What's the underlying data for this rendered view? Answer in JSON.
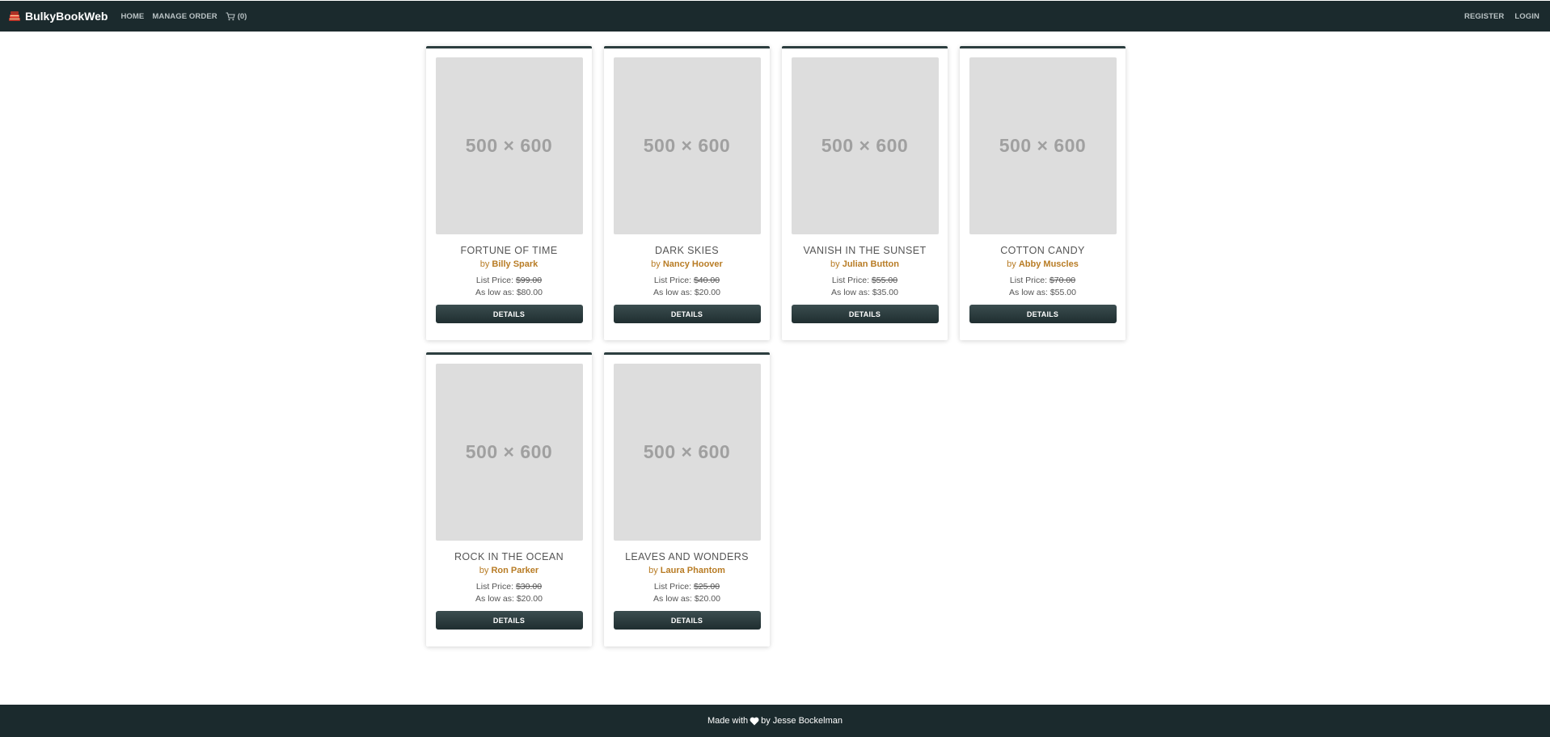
{
  "navbar": {
    "brand": "BulkyBookWeb",
    "brand_icon": "book-stack-icon",
    "links": {
      "home": "HOME",
      "manage_order": "MANAGE ORDER"
    },
    "cart": {
      "icon": "cart-icon",
      "count_label": "(0)"
    },
    "right": {
      "register": "REGISTER",
      "login": "LOGIN"
    }
  },
  "products": [
    {
      "image_label": "500 × 600",
      "title": "FORTUNE OF TIME",
      "by": "by",
      "author": "Billy Spark",
      "list_label": "List Price:",
      "list_price": "$99.00",
      "low_label": "As low as:",
      "low_price": "$80.00",
      "button": "DETAILS"
    },
    {
      "image_label": "500 × 600",
      "title": "DARK SKIES",
      "by": "by",
      "author": "Nancy Hoover",
      "list_label": "List Price:",
      "list_price": "$40.00",
      "low_label": "As low as:",
      "low_price": "$20.00",
      "button": "DETAILS"
    },
    {
      "image_label": "500 × 600",
      "title": "VANISH IN THE SUNSET",
      "by": "by",
      "author": "Julian Button",
      "list_label": "List Price:",
      "list_price": "$55.00",
      "low_label": "As low as:",
      "low_price": "$35.00",
      "button": "DETAILS"
    },
    {
      "image_label": "500 × 600",
      "title": "COTTON CANDY",
      "by": "by",
      "author": "Abby Muscles",
      "list_label": "List Price:",
      "list_price": "$70.00",
      "low_label": "As low as:",
      "low_price": "$55.00",
      "button": "DETAILS"
    },
    {
      "image_label": "500 × 600",
      "title": "ROCK IN THE OCEAN",
      "by": "by",
      "author": "Ron Parker",
      "list_label": "List Price:",
      "list_price": "$30.00",
      "low_label": "As low as:",
      "low_price": "$20.00",
      "button": "DETAILS"
    },
    {
      "image_label": "500 × 600",
      "title": "LEAVES AND WONDERS",
      "by": "by",
      "author": "Laura Phantom",
      "list_label": "List Price:",
      "list_price": "$25.00",
      "low_label": "As low as:",
      "low_price": "$20.00",
      "button": "DETAILS"
    }
  ],
  "footer": {
    "prefix": "Made with",
    "icon": "heart-icon",
    "suffix": "by Jesse Bockelman"
  },
  "colors": {
    "navbar_bg": "#1b2a2d",
    "author_accent": "#b87c25",
    "button_bg": "#2c3e3f",
    "placeholder_bg": "#dddddd"
  }
}
